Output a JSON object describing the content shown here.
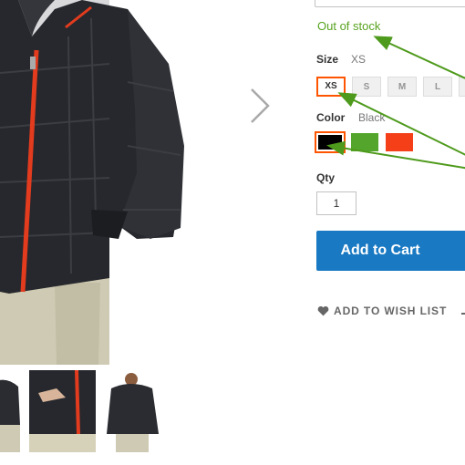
{
  "product": {
    "stock_status": "Out of stock",
    "size": {
      "label": "Size",
      "selected": "XS",
      "options": [
        "XS",
        "S",
        "M",
        "L"
      ]
    },
    "color": {
      "label": "Color",
      "selected": "Black",
      "swatches": [
        "#000000",
        "#53a62b",
        "#f43f19"
      ]
    },
    "qty": {
      "label": "Qty",
      "value": "1"
    },
    "add_to_cart_label": "Add to Cart",
    "wishlist_label": "ADD TO WISH LIST"
  },
  "colors": {
    "accent_blue": "#1979c3",
    "stock_green": "#58a320",
    "selected_border": "#ff5501",
    "annotation_arrow": "#4e9a1c"
  },
  "icons": [
    "chevron-right-icon",
    "heart-icon"
  ]
}
